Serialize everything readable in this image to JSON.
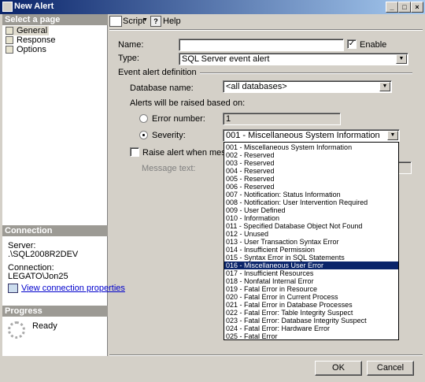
{
  "window": {
    "title": "New Alert",
    "controls": [
      "_",
      "□",
      "×"
    ]
  },
  "left_pane": {
    "select_page_header": "Select a page",
    "pages": [
      "General",
      "Response",
      "Options"
    ],
    "connection_header": "Connection",
    "server_label": "Server:",
    "server_value": ".\\SQL2008R2DEV",
    "connection_label": "Connection:",
    "connection_value": "LEGATO\\Jon25",
    "view_connection_link": "View connection properties",
    "progress_header": "Progress",
    "progress_status": "Ready"
  },
  "toolbar": {
    "script_label": "Script",
    "help_label": "Help"
  },
  "form": {
    "name_label": "Name:",
    "name_value": "",
    "enable_label": "Enable",
    "enable_checked": true,
    "type_label": "Type:",
    "type_value": "SQL Server event alert",
    "event_section_label": "Event alert definition",
    "database_label": "Database name:",
    "database_value": "<all databases>",
    "raised_label": "Alerts will be raised based on:",
    "error_number_label": "Error number:",
    "error_number_value": "1",
    "severity_label": "Severity:",
    "severity_value": "001 - Miscellaneous System Information",
    "raise_alert_label": "Raise alert when message c",
    "message_text_label": "Message text:"
  },
  "severity_options": [
    "001 - Miscellaneous System Information",
    "002 - Reserved",
    "003 - Reserved",
    "004 - Reserved",
    "005 - Reserved",
    "006 - Reserved",
    "007 - Notification: Status Information",
    "008 - Notification: User Intervention Required",
    "009 - User Defined",
    "010 - Information",
    "011 - Specified Database Object Not Found",
    "012 - Unused",
    "013 - User Transaction Syntax Error",
    "014 - Insufficient Permission",
    "015 - Syntax Error in SQL Statements",
    "016 - Miscellaneous User Error",
    "017 - Insufficient Resources",
    "018 - Nonfatal Internal Error",
    "019 - Fatal Error in Resource",
    "020 - Fatal Error in Current Process",
    "021 - Fatal Error in Database Processes",
    "022 - Fatal Error: Table Integrity Suspect",
    "023 - Fatal Error: Database Integrity Suspect",
    "024 - Fatal Error: Hardware Error",
    "025 - Fatal Error"
  ],
  "highlighted_option_index": 15,
  "buttons": {
    "ok": "OK",
    "cancel": "Cancel"
  },
  "colors": {
    "highlight": "#0a246a",
    "link": "#0000cc"
  }
}
